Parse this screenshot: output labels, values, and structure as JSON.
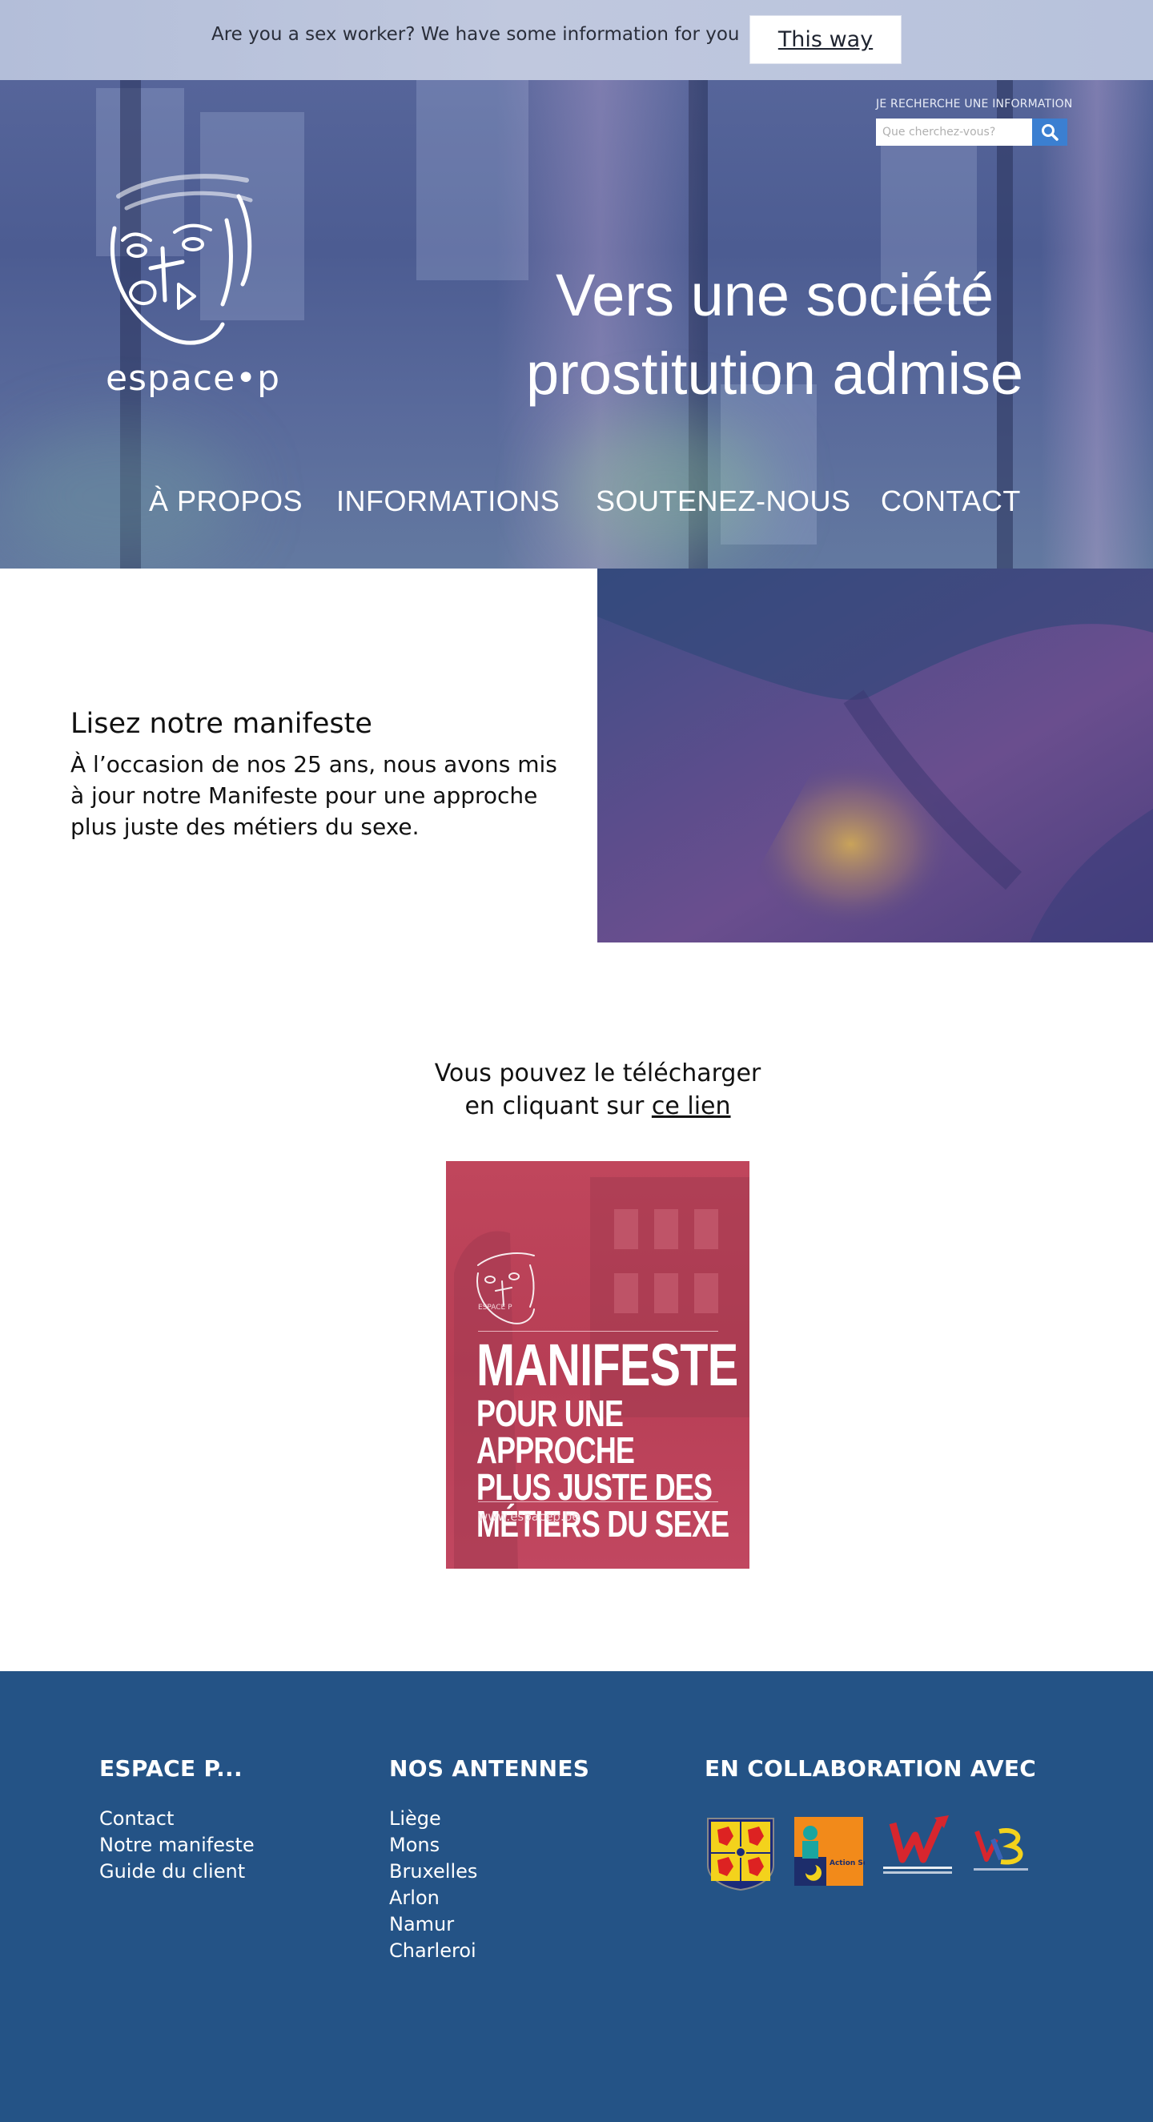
{
  "notice": {
    "text": "Are you a sex worker? We have some information for you",
    "button": "This way"
  },
  "search": {
    "label": "JE RECHERCHE UNE INFORMATION",
    "placeholder": "Que cherchez-vous?",
    "icon": "search-icon"
  },
  "logo": {
    "wordmark": "espace•p"
  },
  "hero": {
    "title": "Vers une société prostitution admise"
  },
  "nav": [
    "À PROPOS",
    "INFORMATIONS",
    "SOUTENEZ-NOUS",
    "CONTACT"
  ],
  "manifest": {
    "heading": "Lisez notre manifeste",
    "body": "À l’occasion de nos 25 ans, nous avons mis à jour notre Manifeste pour une approche plus juste des métiers du sexe."
  },
  "download": {
    "line1": "Vous pouvez le télécharger",
    "line2_prefix": "en cliquant sur ",
    "link": "ce lien"
  },
  "cover": {
    "publisher": "ESPACE P",
    "title_line1": "MANIFESTE",
    "title_line2": "POUR UNE APPROCHE",
    "title_line3": "PLUS JUSTE DES",
    "title_line4": "MÉTIERS DU SEXE",
    "url": "www.espacep.be"
  },
  "footer": {
    "col1": {
      "heading": "ESPACE P...",
      "links": [
        "Contact",
        "Notre manifeste",
        "Guide du client"
      ]
    },
    "col2": {
      "heading": "NOS ANTENNES",
      "links": [
        "Liège",
        "Mons",
        "Bruxelles",
        "Arlon",
        "Namur",
        "Charleroi"
      ]
    },
    "col3": {
      "heading": "EN COLLABORATION AVEC",
      "partners": [
        "wallonia-coat-of-arms-logo",
        "action-sociale-logo",
        "wallonie-w-logo",
        "federation-wallonie-bruxelles-logo"
      ],
      "partner_captions": {
        "action_sociale": "Action Sociale"
      }
    }
  },
  "colors": {
    "footer_bg": "#245386",
    "search_btn": "#3b7fd1",
    "cover_bg": "#be4560"
  }
}
